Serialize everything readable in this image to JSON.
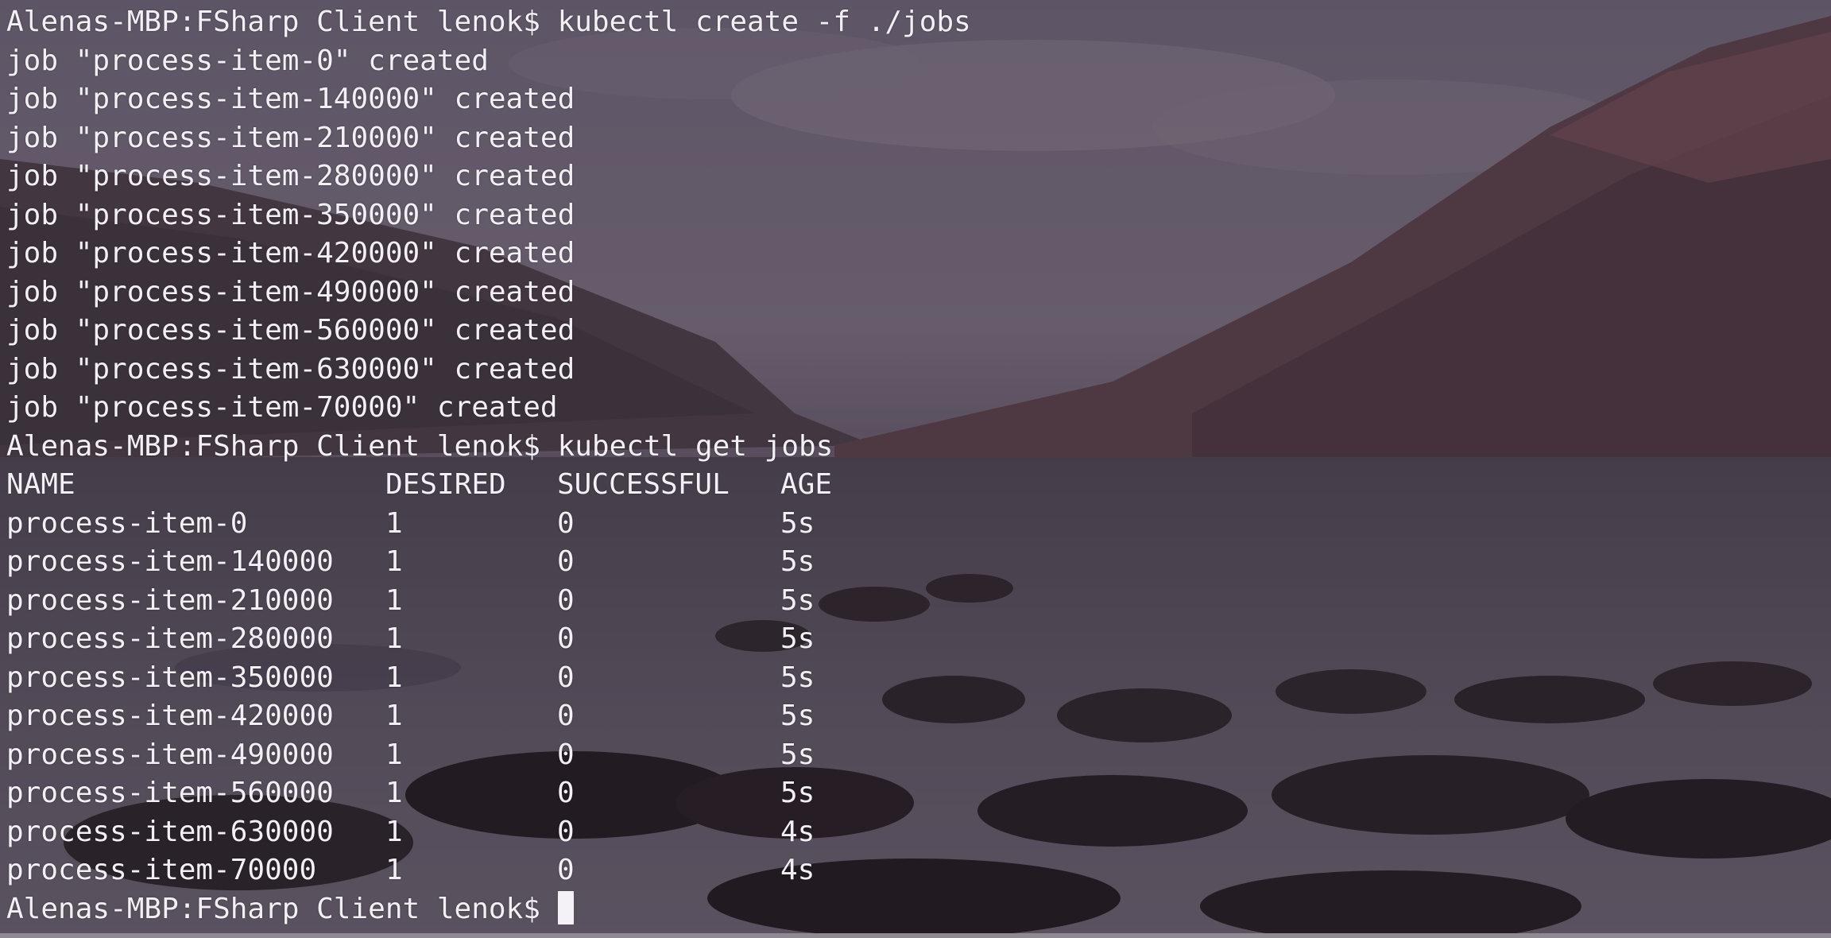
{
  "terminal": {
    "lines": [
      {
        "prompt": "Alenas-MBP:FSharp Client lenok$",
        "command": "kubectl create -f ./jobs"
      },
      {
        "text": "job \"process-item-0\" created"
      },
      {
        "text": "job \"process-item-140000\" created"
      },
      {
        "text": "job \"process-item-210000\" created"
      },
      {
        "text": "job \"process-item-280000\" created"
      },
      {
        "text": "job \"process-item-350000\" created"
      },
      {
        "text": "job \"process-item-420000\" created"
      },
      {
        "text": "job \"process-item-490000\" created"
      },
      {
        "text": "job \"process-item-560000\" created"
      },
      {
        "text": "job \"process-item-630000\" created"
      },
      {
        "text": "job \"process-item-70000\" created"
      },
      {
        "prompt": "Alenas-MBP:FSharp Client lenok$",
        "command": "kubectl get jobs"
      }
    ],
    "jobs_table": {
      "headers": [
        "NAME",
        "DESIRED",
        "SUCCESSFUL",
        "AGE"
      ],
      "rows": [
        [
          "process-item-0",
          "1",
          "0",
          "5s"
        ],
        [
          "process-item-140000",
          "1",
          "0",
          "5s"
        ],
        [
          "process-item-210000",
          "1",
          "0",
          "5s"
        ],
        [
          "process-item-280000",
          "1",
          "0",
          "5s"
        ],
        [
          "process-item-350000",
          "1",
          "0",
          "5s"
        ],
        [
          "process-item-420000",
          "1",
          "0",
          "5s"
        ],
        [
          "process-item-490000",
          "1",
          "0",
          "5s"
        ],
        [
          "process-item-560000",
          "1",
          "0",
          "5s"
        ],
        [
          "process-item-630000",
          "1",
          "0",
          "4s"
        ],
        [
          "process-item-70000",
          "1",
          "0",
          "4s"
        ]
      ]
    },
    "final_prompt": "Alenas-MBP:FSharp Client lenok$",
    "colors": {
      "text": "#f2f0f4",
      "cursor": "#f4f2f6",
      "sky": "#6b6478",
      "mountain": "#4a3c45",
      "water": "#5a5160"
    }
  }
}
